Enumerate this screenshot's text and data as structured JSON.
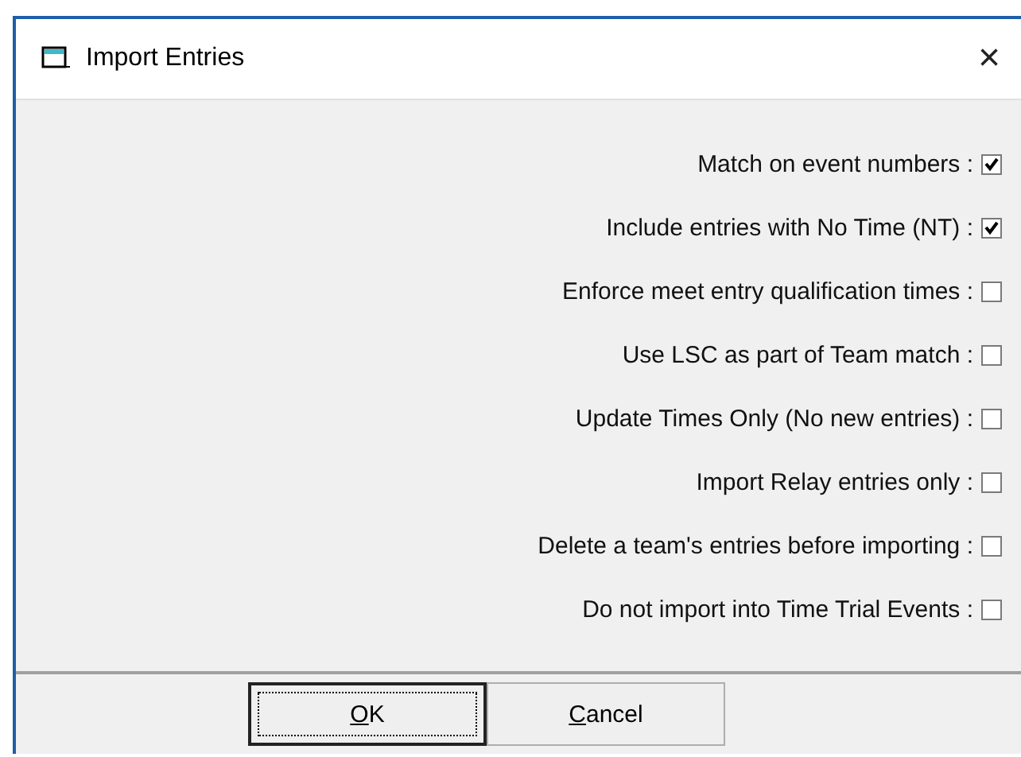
{
  "window": {
    "title": "Import Entries",
    "close": "×"
  },
  "options": [
    {
      "label": "Match on event numbers :",
      "checked": true
    },
    {
      "label": "Include entries with No Time (NT) :",
      "checked": true
    },
    {
      "label": "Enforce meet entry qualification times :",
      "checked": false
    },
    {
      "label": "Use LSC as part of Team match :",
      "checked": false
    },
    {
      "label": "Update Times Only (No new entries) :",
      "checked": false
    },
    {
      "label": "Import Relay entries only :",
      "checked": false
    },
    {
      "label": "Delete a team's entries before importing :",
      "checked": false
    },
    {
      "label": "Do not import into Time Trial Events :",
      "checked": false
    }
  ],
  "buttons": [
    {
      "mnemonic": "O",
      "rest": "K",
      "kind": "default"
    },
    {
      "mnemonic": "C",
      "rest": "ancel",
      "kind": "normal"
    }
  ]
}
